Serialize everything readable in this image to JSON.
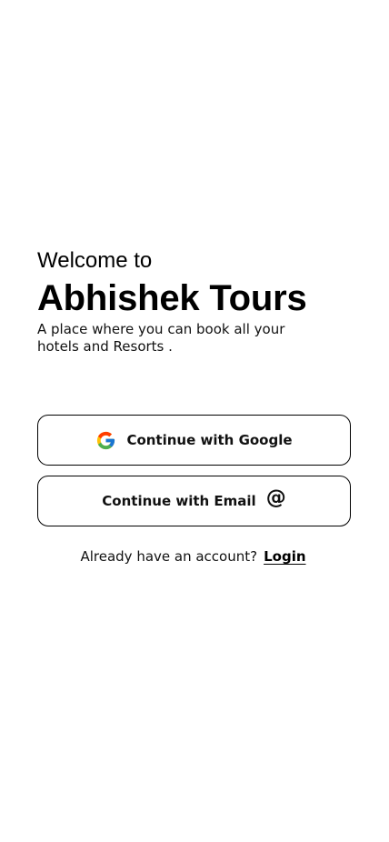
{
  "welcome": {
    "greeting": "Welcome to",
    "brand_name": "Abhishek Tours",
    "tagline": "A place where you can book all your hotels and Resorts ."
  },
  "auth": {
    "google_button": {
      "label": "Continue with Google",
      "icon": "google-icon"
    },
    "email_button": {
      "label": "Continue with Email",
      "icon": "at-sign-icon"
    }
  },
  "footer": {
    "prompt": "Already have an account?",
    "login_label": "Login"
  },
  "colors": {
    "background": "#ffffff",
    "text": "#000000",
    "button_border": "#000000",
    "google_blue": "#4285F4",
    "google_red": "#EA4335",
    "google_yellow": "#FBBC05",
    "google_green": "#34A853"
  }
}
